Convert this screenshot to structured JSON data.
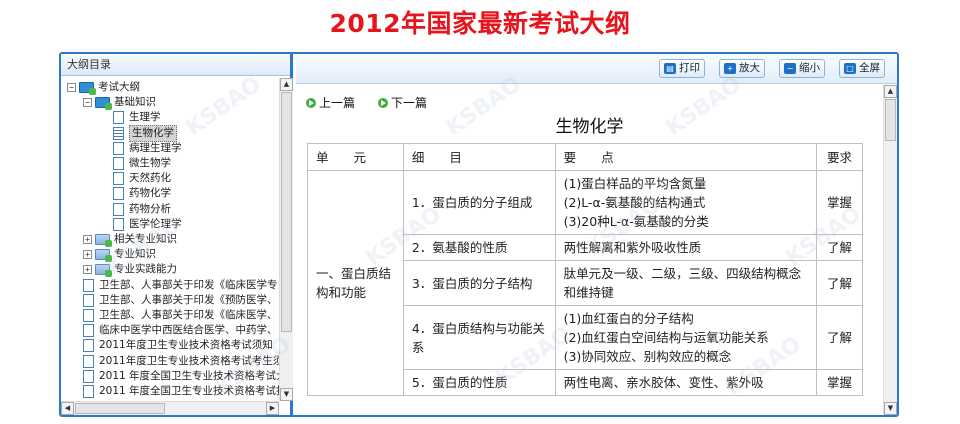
{
  "page_title": "2012年国家最新考试大纲",
  "tree": {
    "header": "大纲目录",
    "nodes": [
      {
        "label": "考试大纲",
        "level": 0,
        "expander": "−",
        "icon": "folder"
      },
      {
        "label": "基础知识",
        "level": 1,
        "expander": "−",
        "icon": "folder"
      },
      {
        "label": "生理学",
        "level": 2,
        "icon": "doc"
      },
      {
        "label": "生物化学",
        "level": 2,
        "icon": "doc-active",
        "selected": true
      },
      {
        "label": "病理生理学",
        "level": 2,
        "icon": "doc"
      },
      {
        "label": "微生物学",
        "level": 2,
        "icon": "doc"
      },
      {
        "label": "天然药化",
        "level": 2,
        "icon": "doc"
      },
      {
        "label": "药物化学",
        "level": 2,
        "icon": "doc"
      },
      {
        "label": "药物分析",
        "level": 2,
        "icon": "doc"
      },
      {
        "label": "医学伦理学",
        "level": 2,
        "icon": "doc"
      },
      {
        "label": "相关专业知识",
        "level": 1,
        "expander": "+",
        "icon": "folder-closed"
      },
      {
        "label": "专业知识",
        "level": 1,
        "expander": "+",
        "icon": "folder-closed"
      },
      {
        "label": "专业实践能力",
        "level": 1,
        "expander": "+",
        "icon": "folder-closed"
      },
      {
        "label": "卫生部、人事部关于印发《临床医学专",
        "level": 0,
        "icon": "doc"
      },
      {
        "label": "卫生部、人事部关于印发《预防医学、",
        "level": 0,
        "icon": "doc"
      },
      {
        "label": "卫生部、人事部关于印发《临床医学、",
        "level": 0,
        "icon": "doc"
      },
      {
        "label": "临床中医学中西医结合医学、中药学、",
        "level": 0,
        "icon": "doc"
      },
      {
        "label": "2011年度卫生专业技术资格考试须知",
        "level": 0,
        "icon": "doc"
      },
      {
        "label": "2011年度卫生专业技术资格考试考生须",
        "level": 0,
        "icon": "doc"
      },
      {
        "label": "2011 年度全国卫生专业技术资格考试大",
        "level": 0,
        "icon": "doc"
      },
      {
        "label": "2011 年度全国卫生专业技术资格考试报",
        "level": 0,
        "icon": "doc"
      }
    ]
  },
  "toolbar": {
    "print_label": "打印",
    "zoom_in_label": "放大",
    "zoom_out_label": "缩小",
    "fullscreen_label": "全屏"
  },
  "content": {
    "prev_label": "上一篇",
    "next_label": "下一篇",
    "title": "生物化学",
    "headers": {
      "unit": "单　　元",
      "detail": "细　　目",
      "point": "要　　点",
      "req": "要求"
    },
    "unit": "一、蛋白质结构和功能",
    "rows": [
      {
        "detail": "1．蛋白质的分子组成",
        "points": [
          "(1)蛋白样品的平均含氮量",
          "(2)L-α-氨基酸的结构通式",
          "(3)20种L-α-氨基酸的分类"
        ],
        "req": "掌握"
      },
      {
        "detail": "2．氨基酸的性质",
        "points": [
          "两性解离和紫外吸收性质"
        ],
        "req": "了解"
      },
      {
        "detail": "3．蛋白质的分子结构",
        "points": [
          "肽单元及一级、二级，三级、四级结构概念和维持键"
        ],
        "req": "了解"
      },
      {
        "detail": "4．蛋白质结构与功能关系",
        "points": [
          "(1)血红蛋白的分子结构",
          "(2)血红蛋白空间结构与运氧功能关系",
          "(3)协同效应、别构效应的概念"
        ],
        "req": "了解"
      },
      {
        "detail": "5．蛋白质的性质",
        "points": [
          "两性电离、亲水胶体、变性、紫外吸"
        ],
        "req": "掌握"
      }
    ]
  },
  "watermark_text": "KSBAO"
}
